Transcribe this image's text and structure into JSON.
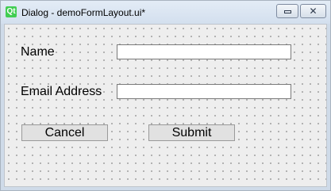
{
  "window": {
    "title": "Dialog - demoFormLayout.ui*",
    "icon_text": "Qt",
    "close_glyph": "✕"
  },
  "form": {
    "name_label": "Name",
    "name_value": "",
    "email_label": "Email Address",
    "email_value": "",
    "cancel_label": "Cancel",
    "submit_label": "Submit"
  }
}
